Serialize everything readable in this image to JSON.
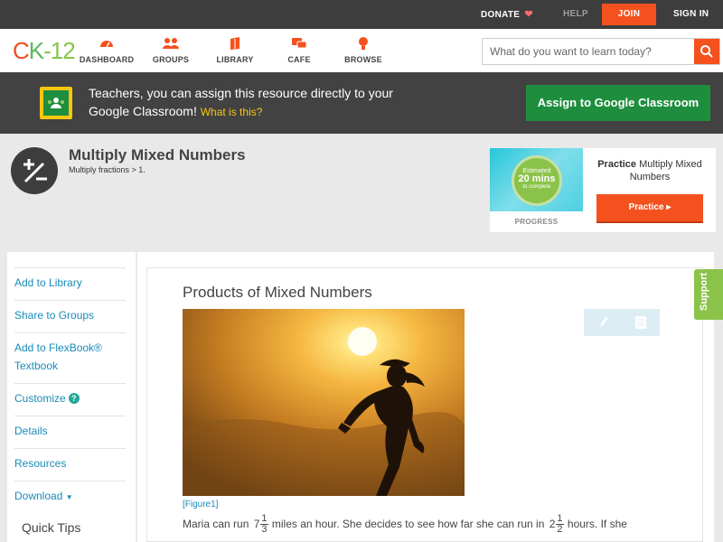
{
  "topbar": {
    "donate": "DONATE",
    "help": "HELP",
    "join": "JOIN",
    "signin": "SIGN IN"
  },
  "logo": {
    "c": "C",
    "k": "K",
    "rest": "-12"
  },
  "nav": [
    {
      "label": "DASHBOARD",
      "icon": "dashboard-icon"
    },
    {
      "label": "GROUPS",
      "icon": "groups-icon"
    },
    {
      "label": "LIBRARY",
      "icon": "library-icon"
    },
    {
      "label": "CAFE",
      "icon": "cafe-icon"
    },
    {
      "label": "BROWSE",
      "icon": "browse-icon"
    }
  ],
  "search": {
    "placeholder": "What do you want to learn today?"
  },
  "google_banner": {
    "message": "Teachers, you can assign this resource directly to your Google Classroom!",
    "what_link": "What is this?",
    "button": "Assign to Google Classroom"
  },
  "concept": {
    "title": "Multiply Mixed Numbers",
    "subtitle": "Multiply fractions > 1."
  },
  "practice_card": {
    "estimated": "Estimated",
    "mins": "20 mins",
    "to_complete": "to complete",
    "progress_label": "PROGRESS",
    "title_bold": "Practice",
    "title_rest": "Multiply Mixed Numbers",
    "button": "Practice"
  },
  "sidebar": {
    "items": [
      "Add to Library",
      "Share to Groups",
      "Add to FlexBook® Textbook",
      "Customize",
      "Details",
      "Resources",
      "Download"
    ],
    "quick_tips": "Quick Tips"
  },
  "content": {
    "section_title": "Products of Mixed Numbers",
    "figure_caption": "[Figure1]",
    "para_part1": "Maria can run",
    "frac1": {
      "whole": "7",
      "num": "1",
      "den": "3"
    },
    "para_part2": "miles an hour. She decides to see how far she can run in",
    "frac2": {
      "whole": "2",
      "num": "1",
      "den": "2"
    },
    "para_part3": "hours. If she"
  },
  "support": "Support",
  "colors": {
    "accent_orange": "#f4511e",
    "google_green": "#1e8e3e",
    "link_blue": "#1a8bb8",
    "support_green": "#8bc34a"
  }
}
